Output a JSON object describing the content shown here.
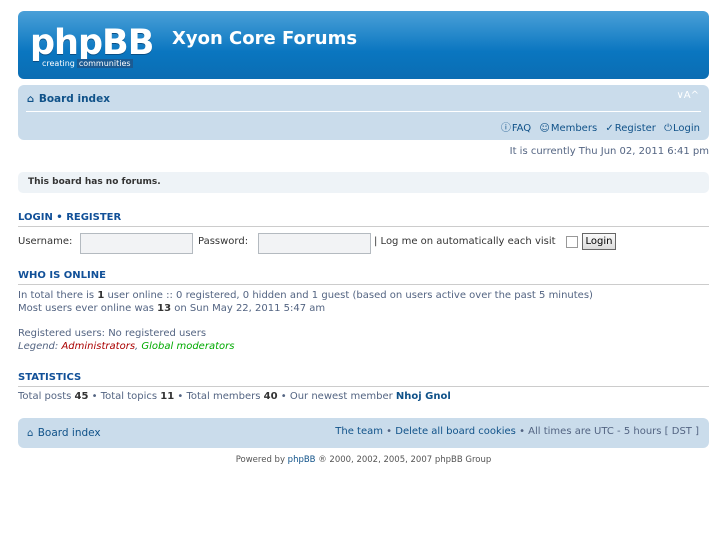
{
  "header": {
    "logo_text": "phpBB",
    "logo_tag_a": "creating",
    "logo_tag_b": "communities",
    "site_title": "Xyon Core Forums"
  },
  "navbar": {
    "breadcrumb": "Board index",
    "font_size_control": "∨A^",
    "links": {
      "faq": "FAQ",
      "members": "Members",
      "register": "Register",
      "login": "Login"
    }
  },
  "current_time": "It is currently Thu Jun 02, 2011 6:41 pm",
  "notice": "This board has no forums.",
  "login_section": {
    "heading_login": "Login",
    "heading_sep": " • ",
    "heading_register": "Register",
    "username_label": "Username:",
    "password_label": "Password:",
    "autologin_label": "| Log me on automatically each visit",
    "login_button": "Login"
  },
  "who_is_online": {
    "heading": "Who is online",
    "line1_pre": "In total there is ",
    "line1_num": "1",
    "line1_post": " user online :: 0 registered, 0 hidden and 1 guest (based on users active over the past 5 minutes)",
    "line2_pre": "Most users ever online was ",
    "line2_num": "13",
    "line2_post": " on Sun May 22, 2011 5:47 am",
    "registered": "Registered users: No registered users",
    "legend_label": "Legend: ",
    "legend_admin": "Administrators",
    "legend_sep": ", ",
    "legend_gmod": "Global moderators"
  },
  "statistics": {
    "heading": "Statistics",
    "posts_label": "Total posts ",
    "posts": "45",
    "topics_label": " • Total topics ",
    "topics": "11",
    "members_label": " • Total members ",
    "members": "40",
    "newest_label": " • Our newest member ",
    "newest": "Nhoj Gnol"
  },
  "footer_nav": {
    "breadcrumb": "Board index",
    "team": "The team",
    "sep1": " • ",
    "delete_cookies": "Delete all board cookies",
    "times": " • All times are UTC - 5 hours [ DST ]"
  },
  "copyright": {
    "pre": "Powered by ",
    "link": "phpBB",
    "post": " ® 2000, 2002, 2005, 2007 phpBB Group"
  },
  "colors": {
    "header_blue": "#0a76c0",
    "navbar_bg": "#cadceb",
    "link": "#105289",
    "admin": "#aa0000",
    "global_mod": "#00aa00"
  },
  "icons": [
    "home-icon",
    "faq-icon",
    "members-icon",
    "register-icon",
    "login-icon"
  ]
}
